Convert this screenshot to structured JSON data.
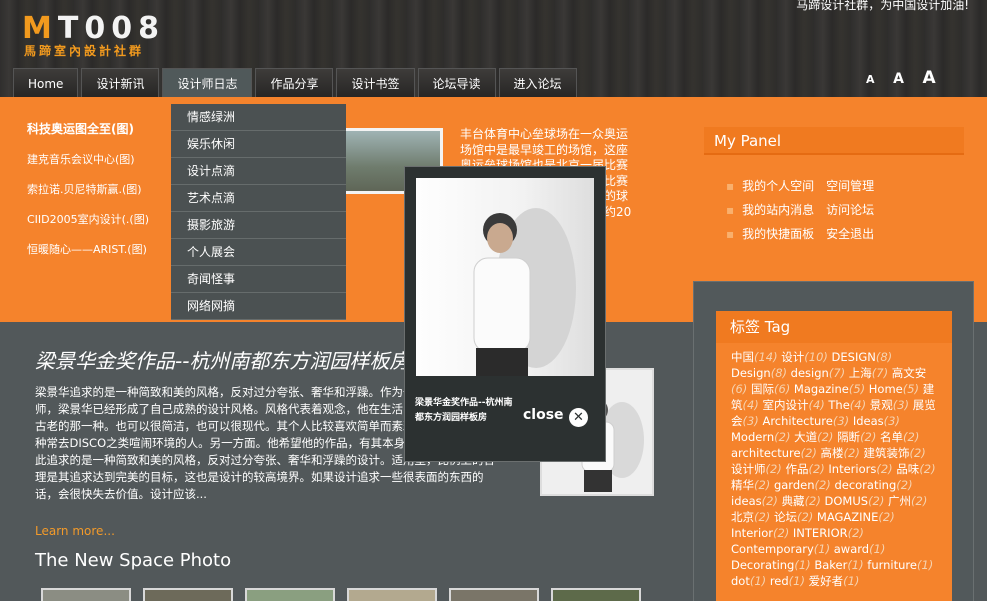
{
  "site": {
    "logo_m": "M",
    "logo_rest": "T008",
    "logo_sub": "馬蹄室內設計社群",
    "slogan": "马蹄设计社群，为中国设计加油!"
  },
  "nav": {
    "items": [
      "Home",
      "设计新讯",
      "设计师日志",
      "作品分享",
      "设计书签",
      "论坛导读",
      "进入论坛"
    ],
    "active_index": 2,
    "font_sizes": [
      "A",
      "A",
      "A"
    ]
  },
  "dropdown": {
    "items": [
      "情感绿洲",
      "娱乐休闲",
      "设计点滴",
      "艺术点滴",
      "摄影旅游",
      "个人展会",
      "奇闻怪事",
      "网络网摘"
    ]
  },
  "headlines": [
    "科技奥运图全至(图)",
    "建克音乐会议中心(图)",
    "索拉诺.贝尼特斯赢.(图)",
    "CIID2005室内设计(.(图)",
    "恒暖随心——ARIST.(图)"
  ],
  "article_preview": "丰台体育中心垒球场在一众奥运场馆中是最早竣工的场馆，这座奥运垒球场馆也是北京一届比赛作为了北京夏季奥运会垒球比赛的场馆。建的一座有设计者的球场，是球场的城，平面占地约20公",
  "mypanel": {
    "title": "My Panel",
    "rows": [
      [
        "我的个人空间",
        "空间管理"
      ],
      [
        "我的站内消息",
        "访问论坛"
      ],
      [
        "我的快捷面板",
        "安全退出"
      ]
    ]
  },
  "tags": {
    "title": "标签 Tag",
    "items": [
      {
        "name": "中国",
        "count": "(14)"
      },
      {
        "name": "设计",
        "count": "(10)"
      },
      {
        "name": "DESIGN",
        "count": "(8)"
      },
      {
        "name": "Design",
        "count": "(8)"
      },
      {
        "name": "design",
        "count": "(7)"
      },
      {
        "name": "上海",
        "count": "(7)"
      },
      {
        "name": "高文安",
        "count": "(6)"
      },
      {
        "name": "国际",
        "count": "(6)"
      },
      {
        "name": "Magazine",
        "count": "(5)"
      },
      {
        "name": "Home",
        "count": "(5)"
      },
      {
        "name": "建筑",
        "count": "(4)"
      },
      {
        "name": "室内设计",
        "count": "(4)"
      },
      {
        "name": "The",
        "count": "(4)"
      },
      {
        "name": "景观",
        "count": "(3)"
      },
      {
        "name": "展览会",
        "count": "(3)"
      },
      {
        "name": "Architecture",
        "count": "(3)"
      },
      {
        "name": "Ideas",
        "count": "(3)"
      },
      {
        "name": "Modern",
        "count": "(2)"
      },
      {
        "name": "大道",
        "count": "(2)"
      },
      {
        "name": "隔断",
        "count": "(2)"
      },
      {
        "name": "名单",
        "count": "(2)"
      },
      {
        "name": "architecture",
        "count": "(2)"
      },
      {
        "name": "高楼",
        "count": "(2)"
      },
      {
        "name": "建筑装饰",
        "count": "(2)"
      },
      {
        "name": "设计师",
        "count": "(2)"
      },
      {
        "name": "作品",
        "count": "(2)"
      },
      {
        "name": "Interiors",
        "count": "(2)"
      },
      {
        "name": "品味",
        "count": "(2)"
      },
      {
        "name": "精华",
        "count": "(2)"
      },
      {
        "name": "garden",
        "count": "(2)"
      },
      {
        "name": "decorating",
        "count": "(2)"
      },
      {
        "name": "ideas",
        "count": "(2)"
      },
      {
        "name": "典藏",
        "count": "(2)"
      },
      {
        "name": "DOMUS",
        "count": "(2)"
      },
      {
        "name": "广州",
        "count": "(2)"
      },
      {
        "name": "北京",
        "count": "(2)"
      },
      {
        "name": "论坛",
        "count": "(2)"
      },
      {
        "name": "MAGAZINE",
        "count": "(2)"
      },
      {
        "name": "Interior",
        "count": "(2)"
      },
      {
        "name": "INTERIOR",
        "count": "(2)"
      },
      {
        "name": "Contemporary",
        "count": "(1)"
      },
      {
        "name": "award",
        "count": "(1)"
      },
      {
        "name": "Decorating",
        "count": "(1)"
      },
      {
        "name": "Baker",
        "count": "(1)"
      },
      {
        "name": "furniture",
        "count": "(1)"
      },
      {
        "name": "dot",
        "count": "(1)"
      },
      {
        "name": "red",
        "count": "(1)"
      },
      {
        "name": "爱好者",
        "count": "(1)"
      }
    ]
  },
  "article": {
    "title": "梁景华金奖作品--杭州南都东方润园样板房",
    "body": "梁景华追求的是一种简致和美的风格，反对过分夸张、奢华和浮躁。作为一名成熟的设计师，梁景华已经形成了自己成熟的设计风格。风格代表着观念，他在生活中也是一个非豪华古老的那一种。也可以很简洁，也可以很现代。其个人比较喜欢简单而素雅的东西。不是那种常去DISCO之类喧闹环境的人。另一方面。他希望他的作品，有其本身的艺术价值。因此追求的是一种简致和美的风格，反对过分夸张、奢华和浮躁的设计。适用型，比例上的合理是其追求达到完美的目标，这也是设计的较高境界。如果设计追求一些很表面的东西的话，会很快失去价值。设计应该...",
    "learn_more": "Learn more...",
    "section_title": "The New Space Photo"
  },
  "popup": {
    "caption": "梁景华金奖作品--杭州南都东方润园样板房",
    "close_label": "close",
    "close_icon": "close-circle-icon"
  },
  "colors": {
    "accent": "#f5832c",
    "dark": "#52585a",
    "header": "#2f2e2d"
  }
}
